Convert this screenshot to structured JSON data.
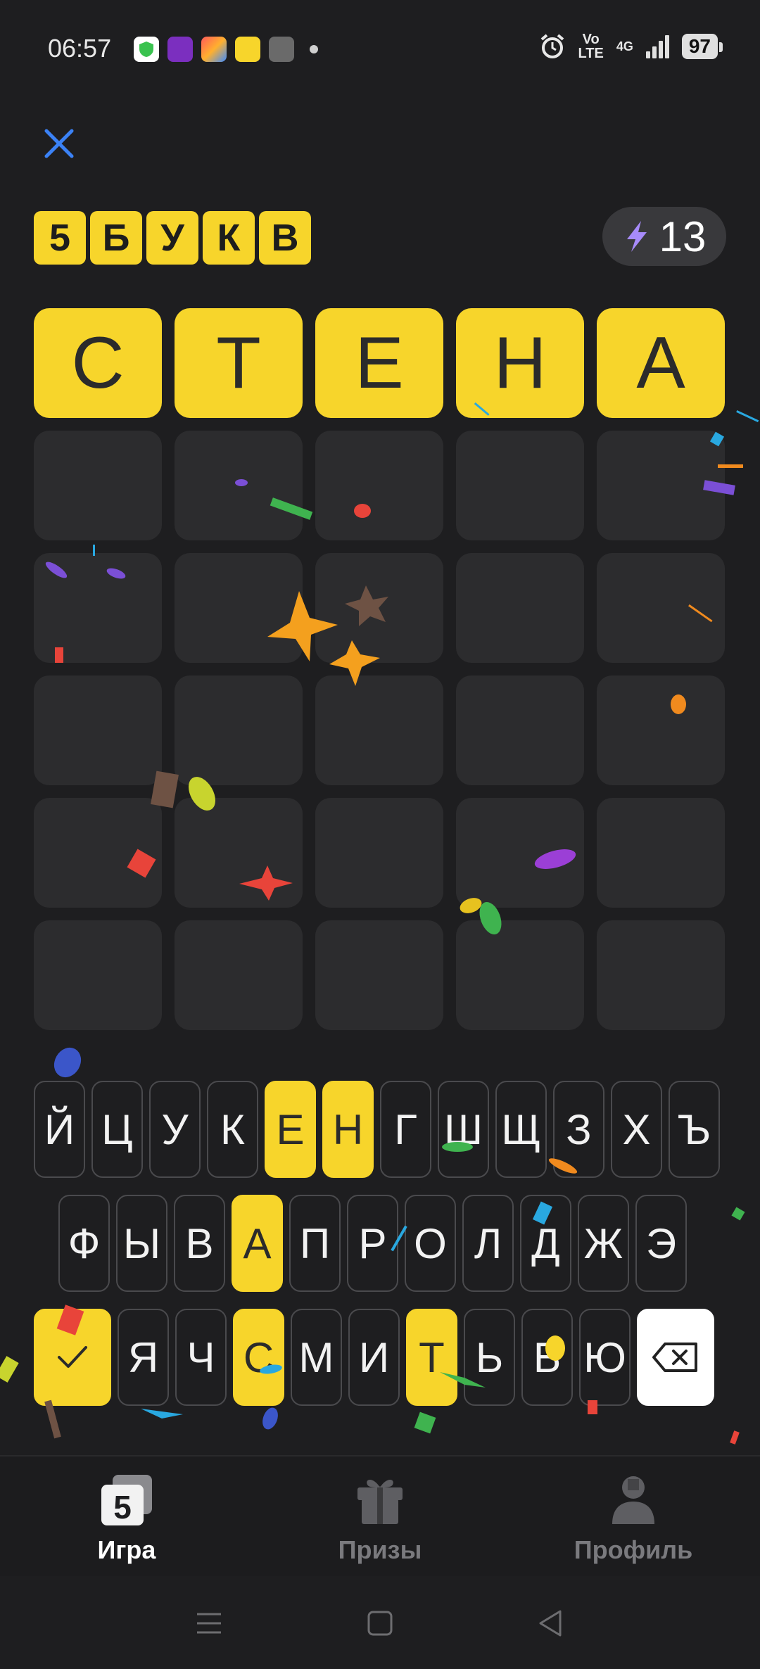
{
  "status_bar": {
    "time": "06:57",
    "network": "4G",
    "volte": "Vo\nLTE",
    "battery": "97"
  },
  "header": {
    "close_icon": "close-icon",
    "logo_letters": [
      "5",
      "Б",
      "У",
      "К",
      "В"
    ],
    "energy": {
      "icon": "lightning-icon",
      "value": "13"
    }
  },
  "board": {
    "rows": [
      [
        "С",
        "Т",
        "Е",
        "Н",
        "А"
      ],
      [
        "",
        "",
        "",
        "",
        ""
      ],
      [
        "",
        "",
        "",
        "",
        ""
      ],
      [
        "",
        "",
        "",
        "",
        ""
      ],
      [
        "",
        "",
        "",
        "",
        ""
      ],
      [
        "",
        "",
        "",
        "",
        ""
      ]
    ],
    "solved_color": "#f7d52b"
  },
  "keyboard": {
    "row1": [
      "Й",
      "Ц",
      "У",
      "К",
      "Е",
      "Н",
      "Г",
      "Ш",
      "Щ",
      "З",
      "Х",
      "Ъ"
    ],
    "row2": [
      "Ф",
      "Ы",
      "В",
      "А",
      "П",
      "Р",
      "О",
      "Л",
      "Д",
      "Ж",
      "Э"
    ],
    "row3": [
      "Я",
      "Ч",
      "С",
      "М",
      "И",
      "Т",
      "Ь",
      "Б",
      "Ю"
    ],
    "highlighted": [
      "Е",
      "Н",
      "А",
      "С",
      "Т"
    ],
    "enter_icon": "checkmark-icon",
    "backspace_icon": "backspace-icon"
  },
  "tabs": [
    {
      "label": "Игра",
      "icon": "game-5-icon",
      "active": true
    },
    {
      "label": "Призы",
      "icon": "gift-icon",
      "active": false
    },
    {
      "label": "Профиль",
      "icon": "profile-icon",
      "active": false
    }
  ],
  "colors": {
    "accent": "#f7d52b",
    "background": "#1e1e20",
    "cell": "#2c2c2e"
  }
}
